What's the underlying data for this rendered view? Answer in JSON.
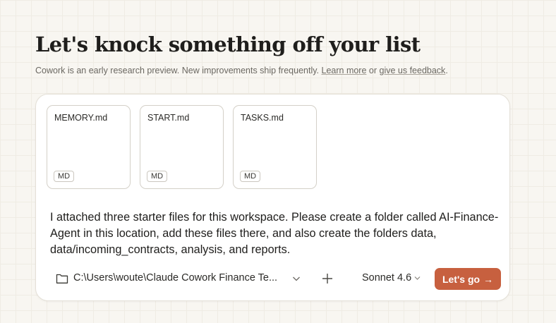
{
  "header": {
    "title": "Let's knock something off your list",
    "subtitle_prefix": "Cowork is an early research preview. New improvements ship frequently. ",
    "learn_more": "Learn more",
    "subtitle_mid": " or ",
    "feedback": "give us feedback",
    "subtitle_suffix": "."
  },
  "files": [
    {
      "name": "MEMORY.md",
      "badge": "MD"
    },
    {
      "name": "START.md",
      "badge": "MD"
    },
    {
      "name": "TASKS.md",
      "badge": "MD"
    }
  ],
  "prompt": {
    "text": "I attached three starter files for this workspace. Please create a folder called AI-Finance-Agent in this location, add these files there, and also create the folders data, data/incoming_contracts, analysis, and reports."
  },
  "toolbar": {
    "folder_path": "C:\\Users\\woute\\Claude Cowork Finance Te...",
    "model": "Sonnet 4.6",
    "go_label": "Let's go",
    "go_arrow": "→",
    "accent_color": "#c7603f",
    "icons": [
      "folder-icon",
      "chevron-down-icon",
      "plus-icon",
      "arrow-right-icon"
    ]
  }
}
